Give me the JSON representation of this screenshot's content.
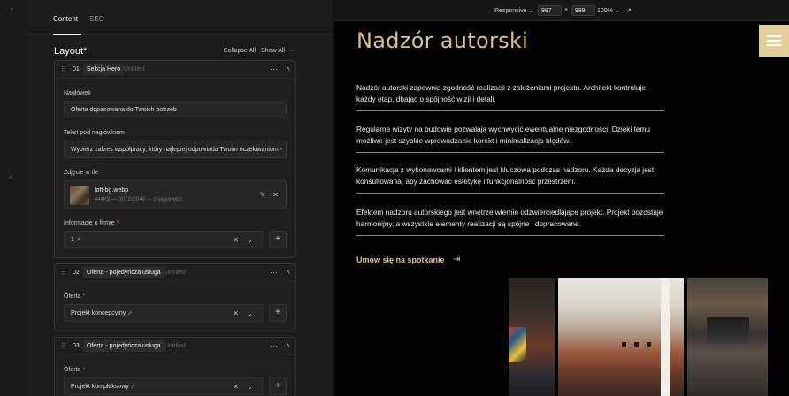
{
  "editor": {
    "tabs": [
      {
        "label": "Content",
        "active": true
      },
      {
        "label": "SEO",
        "active": false
      }
    ],
    "layout_title": "Layout*",
    "collapse_all": "Collapse All",
    "show_all": "Show All",
    "more": "···",
    "blocks": [
      {
        "num": "01",
        "name": "Sekcja Hero",
        "status": "Untitled",
        "fields": {
          "heading_label": "Nagłówek",
          "heading_value": "Oferta dopasowana do Twoich potrzeb",
          "subheading_label": "Tekst pod nagłówkiem",
          "subheading_value": "Wybierz zakres współpracy, który najlepiej odpowiada Twoim oczekiwaniom -",
          "image_label": "Zdjęcie w tle",
          "image_name": "loft-bg.webp",
          "image_meta": "444KB — 3072x2048 — image/webp",
          "company_label": "Informacje o firmie",
          "company_value": "1"
        }
      },
      {
        "num": "02",
        "name": "Oferta - pojedyńcza usługa",
        "status": "Untitled",
        "fields": {
          "offer_label": "Oferta",
          "offer_value": "Projekt koncepcyjny"
        }
      },
      {
        "num": "03",
        "name": "Oferta - pojedyńcza usługa",
        "status": "Untitled",
        "fields": {
          "offer_label": "Oferta",
          "offer_value": "Projekt kompleksowy"
        }
      }
    ]
  },
  "toolbar": {
    "device": "Responsive",
    "width": "987",
    "times": "×",
    "height": "989",
    "zoom": "100%"
  },
  "preview": {
    "title": "Nadzór autorski",
    "paragraphs": [
      "Nadzór autorski zapewnia zgodność realizacji z założeniami projektu. Architekt kontroluje każdy etap, dbając o spójność wizji i detali.",
      "Regularne wizyty na budowie pozwalają wychwycić ewentualne niezgodności. Dzięki temu możliwe jest szybkie wprowadzanie korekt i minimalizacja błędów.",
      "Komunikacja z wykonawcami i klientem jest kluczowa podczas nadzoru. Każda decyzja jest konsultowana, aby zachować estetykę i funkcjonalność przestrzeni.",
      "Efektem nadzoru autorskiego jest wnętrze wiernie odzwierciedlające projekt. Projekt pozostaje harmonijny, a wszystkie elementy realizacji są spójne i dopracowane."
    ],
    "cta": "Umów się na spotkanie"
  },
  "colors": {
    "accent": "#d7c09a",
    "burger": "#e3cf9a"
  }
}
